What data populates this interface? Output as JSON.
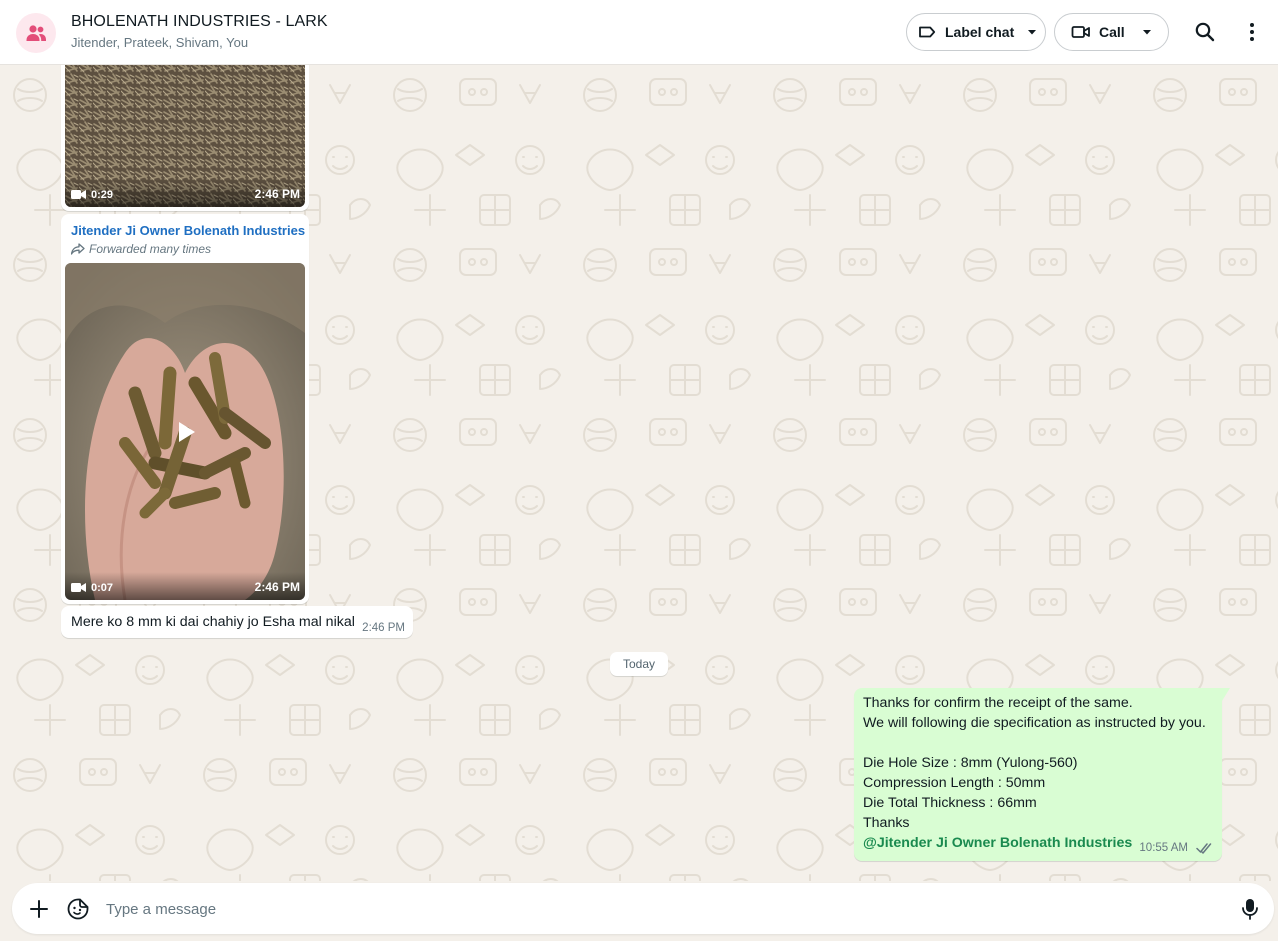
{
  "header": {
    "title": "BHOLENATH INDUSTRIES - LARK",
    "participants": "Jitender, Prateek, Shivam, You",
    "label_chat": "Label chat",
    "call": "Call",
    "avatar_icon": "group-icon",
    "accent_color": "#e34d79"
  },
  "messages": {
    "video1": {
      "duration": "0:29",
      "time": "2:46 PM"
    },
    "video2": {
      "sender": "Jitender Ji Owner Bolenath Industries",
      "forwarded": "Forwarded many times",
      "duration": "0:07",
      "time": "2:46 PM"
    },
    "text1": {
      "text": "Mere ko 8 mm ki dai chahiy jo Esha mal nikal",
      "time": "2:46 PM"
    },
    "date_divider": "Today",
    "outgoing": {
      "lines": [
        "Thanks for confirm the receipt of the same.",
        "We will following die specification as instructed by you.",
        "",
        "Die Hole Size : 8mm (Yulong-560)",
        "Compression Length : 50mm",
        "Die Total Thickness : 66mm",
        "Thanks"
      ],
      "mention": "@Jitender Ji Owner Bolenath Industries",
      "time": "10:55 AM",
      "status": "read"
    }
  },
  "composer": {
    "placeholder": "Type a message"
  },
  "colors": {
    "outgoing_bubble": "#d9fdd3",
    "incoming_bubble": "#ffffff",
    "chat_background": "#f4f0ea",
    "sender_name": "#1f6fc2",
    "mention": "#1a8a4f"
  }
}
